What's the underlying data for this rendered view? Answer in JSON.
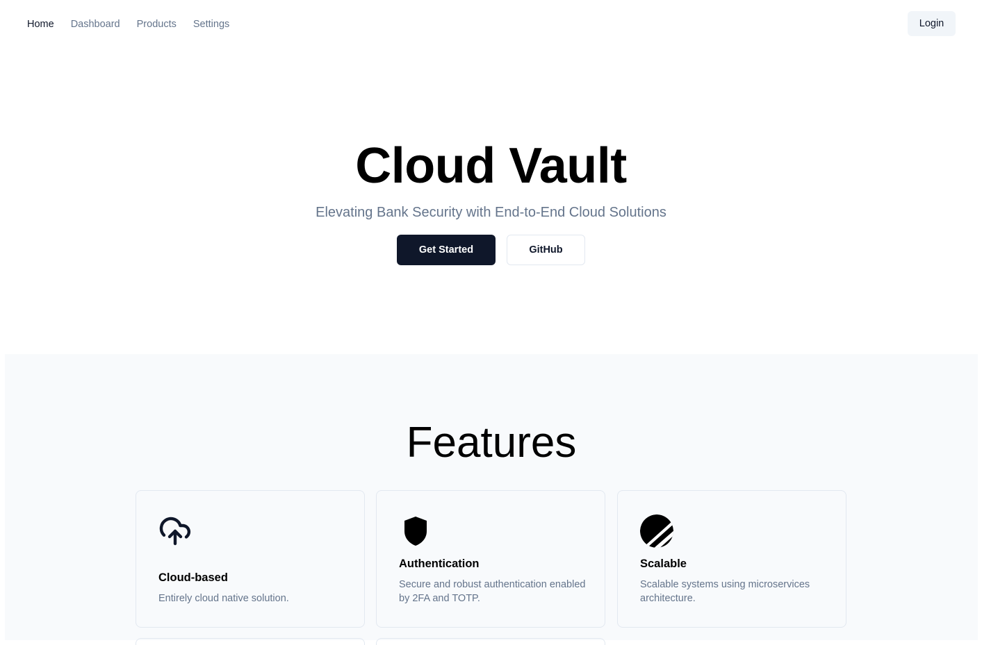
{
  "nav": {
    "items": [
      {
        "label": "Home",
        "active": true
      },
      {
        "label": "Dashboard",
        "active": false
      },
      {
        "label": "Products",
        "active": false
      },
      {
        "label": "Settings",
        "active": false
      }
    ],
    "login_label": "Login"
  },
  "hero": {
    "title": "Cloud Vault",
    "subtitle": "Elevating Bank Security with End-to-End Cloud Solutions",
    "primary_button": "Get Started",
    "secondary_button": "GitHub"
  },
  "features": {
    "title": "Features",
    "cards": [
      {
        "icon": "cloud-upload-icon",
        "title": "Cloud-based",
        "description": "Entirely cloud native solution."
      },
      {
        "icon": "shield-icon",
        "title": "Authentication",
        "description": "Secure and robust authentication enabled by 2FA and TOTP."
      },
      {
        "icon": "planetscale-icon",
        "title": "Scalable",
        "description": "Scalable systems using microservices architecture."
      }
    ]
  },
  "colors": {
    "primary": "#0f172a",
    "muted_text": "#64748b",
    "section_bg": "#f8fafc",
    "border": "#e2e8f0"
  }
}
